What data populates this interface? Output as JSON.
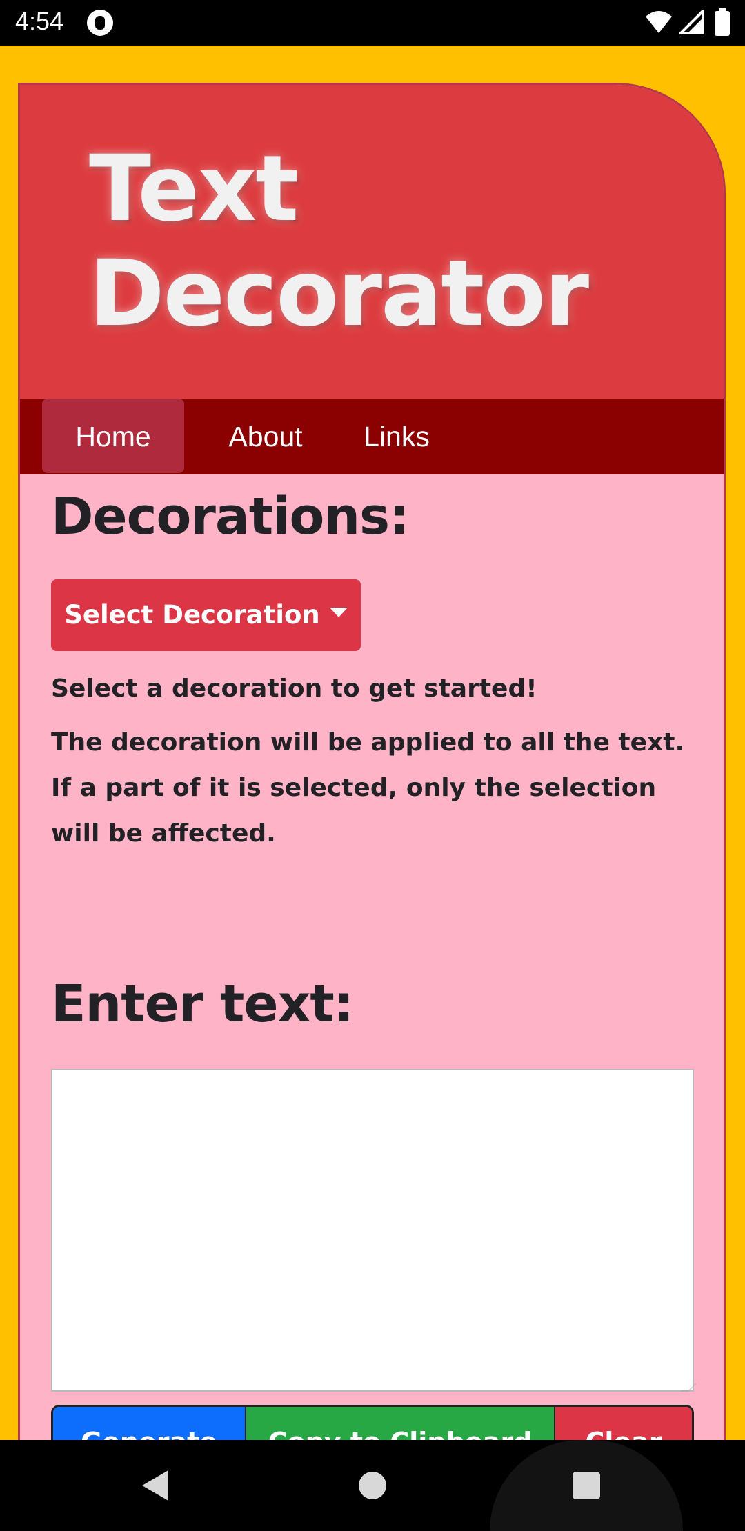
{
  "status_bar": {
    "time": "4:54"
  },
  "header": {
    "title_line1": "Text",
    "title_line2": "Decorator"
  },
  "nav": {
    "items": [
      {
        "label": "Home"
      },
      {
        "label": "About"
      },
      {
        "label": "Links"
      }
    ]
  },
  "decorations": {
    "heading": "Decorations:",
    "dropdown_label": "Select Decoration",
    "hint": "Select a decoration to get started!",
    "description": "The decoration will be applied to all the text. If a part of it is selected, only the selection will be affected."
  },
  "enter_text": {
    "heading": "Enter text:",
    "value": ""
  },
  "buttons": {
    "generate": "Generate",
    "copy": "Copy to Clipboard",
    "clear": "Clear"
  },
  "colors": {
    "page_bg": "#ffc000",
    "header_bg": "#dc3c3f",
    "nav_bg": "#8b0000",
    "content_bg": "#ffb3c7",
    "primary": "#0d6efd",
    "success": "#28a745",
    "danger": "#dc3545"
  }
}
